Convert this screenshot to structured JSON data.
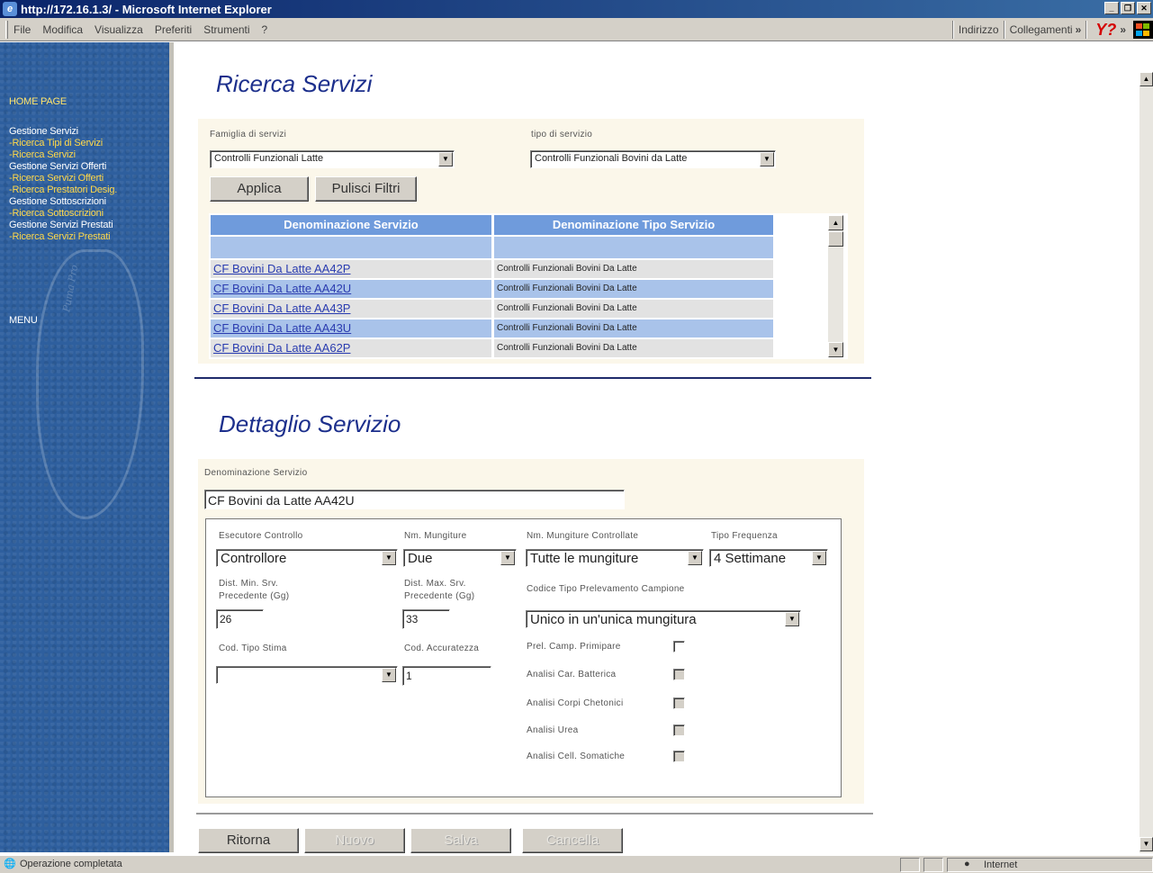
{
  "window": {
    "title": "http://172.16.1.3/ - Microsoft Internet Explorer"
  },
  "menu": {
    "file": "File",
    "edit": "Modifica",
    "view": "Visualizza",
    "favorites": "Preferiti",
    "tools": "Strumenti",
    "help": "?",
    "address": "Indirizzo",
    "links": "Collegamenti",
    "links_more": "»",
    "yahoo": "Y?",
    "more": "»"
  },
  "sidebar": {
    "home": "HOME PAGE",
    "items": [
      {
        "label": "Gestione Servizi",
        "kind": "title"
      },
      {
        "label": "-Ricerca Tipi di Servizi",
        "kind": "sub"
      },
      {
        "label": "-Ricerca Servizi",
        "kind": "sub"
      },
      {
        "label": "Gestione Servizi Offerti",
        "kind": "title"
      },
      {
        "label": "-Ricerca Servizi Offerti",
        "kind": "sub"
      },
      {
        "label": "-Ricerca Prestatori Desig.",
        "kind": "sub"
      },
      {
        "label": "Gestione Sottoscrizioni",
        "kind": "title"
      },
      {
        "label": "-Ricerca Sottoscrizioni",
        "kind": "sub"
      },
      {
        "label": "Gestione Servizi Prestati",
        "kind": "title"
      },
      {
        "label": "-Ricerca Servizi Prestati",
        "kind": "sub"
      }
    ],
    "menu": "MENU",
    "deco_text": "Puma Pro"
  },
  "search": {
    "title": "Ricerca Servizi",
    "family_label": "Famiglia di servizi",
    "family_value": "Controlli Funzionali Latte",
    "type_label": "tipo di servizio",
    "type_value": "Controlli Funzionali Bovini da Latte",
    "apply": "Applica",
    "clear": "Pulisci Filtri"
  },
  "table": {
    "headers": [
      "Denominazione Servizio",
      "Denominazione Tipo Servizio"
    ],
    "rows": [
      {
        "name": "CF Bovini Da Latte AA42P",
        "type": "Controlli Funzionali Bovini Da Latte"
      },
      {
        "name": "CF Bovini Da Latte AA42U",
        "type": "Controlli Funzionali Bovini Da Latte"
      },
      {
        "name": "CF Bovini Da Latte AA43P",
        "type": "Controlli Funzionali Bovini Da Latte"
      },
      {
        "name": "CF Bovini Da Latte AA43U",
        "type": "Controlli Funzionali Bovini Da Latte"
      },
      {
        "name": "CF Bovini Da Latte AA62P",
        "type": "Controlli Funzionali Bovini Da Latte"
      }
    ]
  },
  "detail": {
    "title": "Dettaglio Servizio",
    "name_label": "Denominazione Servizio",
    "name_value": "CF Bovini da Latte AA42U",
    "executor_label": "Esecutore Controllo",
    "executor_value": "Controllore",
    "milkings_label": "Nm. Mungiture",
    "milkings_value": "Due",
    "controlled_label": "Nm. Mungiture Controllate",
    "controlled_value": "Tutte le mungiture",
    "freq_label": "Tipo Frequenza",
    "freq_value": "4 Settimane",
    "dist_min_label_1": "Dist. Min. Srv.",
    "dist_min_label_2": "Precedente (Gg)",
    "dist_min_value": "26",
    "dist_max_label_1": "Dist. Max. Srv.",
    "dist_max_label_2": "Precedente (Gg)",
    "dist_max_value": "33",
    "sample_label": "Codice Tipo Prelevamento Campione",
    "sample_value": "Unico in un'unica mungitura",
    "estimate_label": "Cod. Tipo Stima",
    "estimate_value": "",
    "accuracy_label": "Cod. Accuratezza",
    "accuracy_value": "1",
    "checks": [
      {
        "label": "Prel. Camp. Primipare",
        "enabled": true
      },
      {
        "label": "Analisi Car. Batterica",
        "enabled": false
      },
      {
        "label": "Analisi Corpi Chetonici",
        "enabled": false
      },
      {
        "label": "Analisi Urea",
        "enabled": false
      },
      {
        "label": "Analisi Cell. Somatiche",
        "enabled": false
      }
    ]
  },
  "actions": {
    "back": "Ritorna",
    "new": "Nuovo",
    "save": "Salva",
    "delete": "Cancella"
  },
  "status": {
    "text": "Operazione completata",
    "zone": "Internet"
  }
}
